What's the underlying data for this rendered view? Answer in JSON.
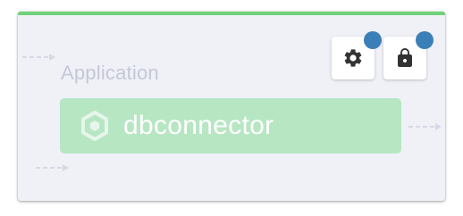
{
  "node": {
    "type_label": "Application",
    "name": "dbconnector"
  },
  "buttons": {
    "settings": {
      "icon": "gear-icon"
    },
    "lock": {
      "icon": "lock-icon"
    }
  },
  "colors": {
    "accent_top": "#6fd27a",
    "name_bar": "#b7e6c3",
    "badge_dot": "#3b7fb8",
    "icon_dark": "#333333",
    "card_bg": "#f0f1f7",
    "type_label": "#c4c7d8",
    "connector_arrow": "#d6d9e4"
  }
}
